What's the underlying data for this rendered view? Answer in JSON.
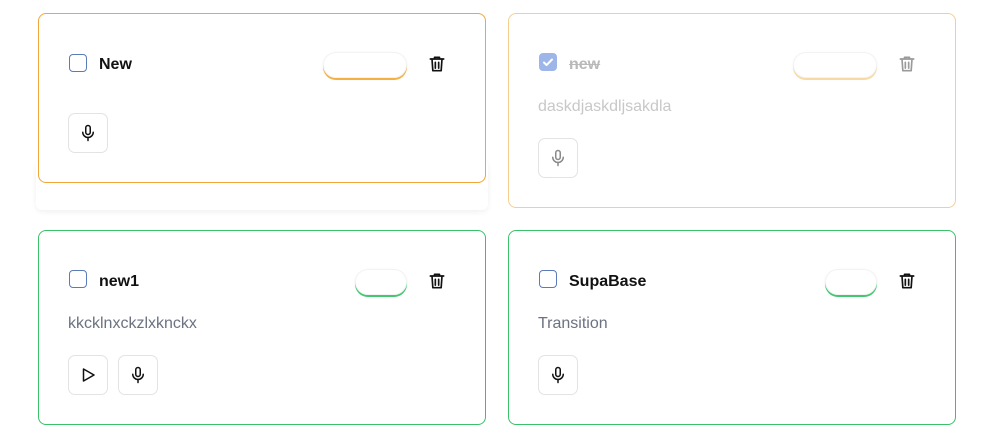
{
  "tasks": [
    {
      "title": "New",
      "description": "",
      "completed": false,
      "status_label": "",
      "status_color": "#f0a63a"
    },
    {
      "title": "new",
      "description": "daskdjaskdljsakdla",
      "completed": true,
      "status_label": "",
      "status_color": "#f6cf90"
    },
    {
      "title": "new1",
      "description": "kkcklnxckzlxknckx",
      "completed": false,
      "status_label": "",
      "status_color": "#39c26a"
    },
    {
      "title": "SupaBase",
      "description": "Transition",
      "completed": false,
      "status_label": "",
      "status_color": "#39c26a"
    }
  ],
  "icons": {
    "checkbox": "checkbox-icon",
    "delete": "trash-icon",
    "record": "microphone-icon",
    "play": "play-icon"
  }
}
